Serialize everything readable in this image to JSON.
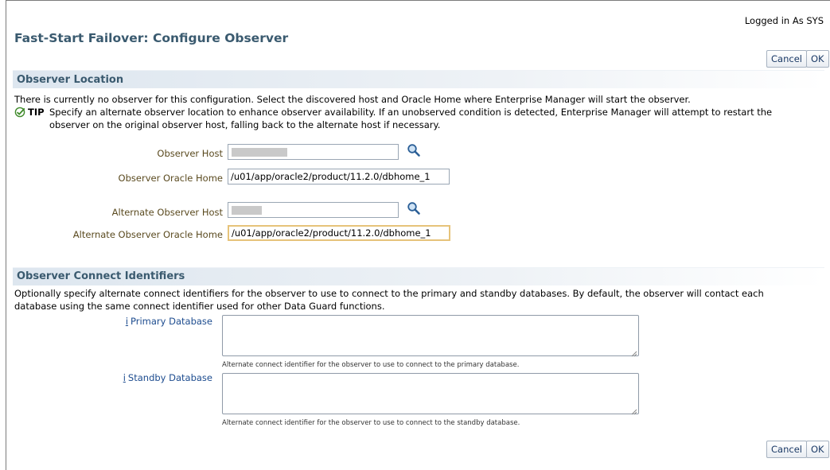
{
  "header": {
    "logged_in": "Logged in As SYS",
    "title": "Fast-Start Failover: Configure Observer",
    "cancel_label": "Cancel",
    "ok_label": "OK"
  },
  "observer_location": {
    "title": "Observer Location",
    "description": "There is currently no observer for this configuration. Select the discovered host and Oracle Home where Enterprise Manager will start the observer.",
    "tip_label": "TIP",
    "tip_line1": "Specify an alternate observer location to enhance observer availability. If an unobserved condition is detected, Enterprise Manager will attempt to restart the",
    "tip_line2": "observer on the original observer host, falling back to the alternate host if necessary.",
    "observer_host_label": "Observer Host",
    "observer_host_value": "",
    "observer_oracle_home_label": "Observer Oracle Home",
    "observer_oracle_home_value": "/u01/app/oracle2/product/11.2.0/dbhome_1",
    "alternate_host_label": "Alternate Observer Host",
    "alternate_host_value": "",
    "alternate_oracle_home_label": "Alternate Observer Oracle Home",
    "alternate_oracle_home_value": "/u01/app/oracle2/product/11.2.0/dbhome_1"
  },
  "connect_identifiers": {
    "title": "Observer Connect Identifiers",
    "description_line1": "Optionally specify alternate connect identifiers for the observer to use to connect to the primary and standby databases. By default, the observer will contact each",
    "description_line2": "database using the same connect identifier used for other Data Guard functions.",
    "info_glyph": "i",
    "primary_label": "Primary Database",
    "primary_value": "",
    "primary_hint": "Alternate connect identifier for the observer to use to connect to the primary database.",
    "standby_label": "Standby Database",
    "standby_value": "",
    "standby_hint": "Alternate connect identifier for the observer to use to connect to the standby database."
  },
  "footer": {
    "cancel_label": "Cancel",
    "ok_label": "OK"
  },
  "colors": {
    "section_title": "#3a5a6f",
    "label": "#5a4a1f",
    "button_text": "#1b3a66",
    "focus_border": "#e6c37a"
  }
}
